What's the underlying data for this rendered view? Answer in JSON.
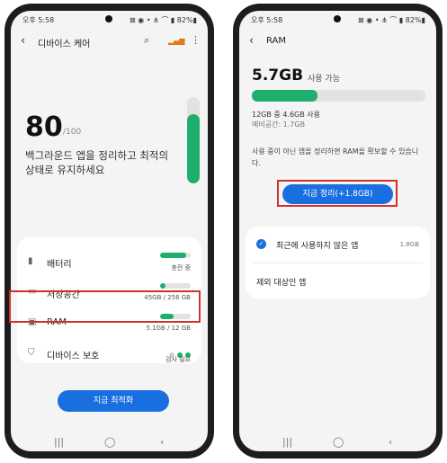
{
  "status_bar": {
    "time": "오후 5:58",
    "icons": "⊠ ◉ • ⋔ ⌒ ▮ 82%▮"
  },
  "left": {
    "appbar": {
      "back": "‹",
      "title": "디바이스 케어",
      "search": "⌕",
      "signal": "▂▄▆",
      "more": "⋮"
    },
    "score": {
      "value": "80",
      "max": "/100",
      "fill": 0.8
    },
    "description": "백그라운드 앱을 정리하고 최적의 상태로 유지하세요",
    "items": [
      {
        "icon": "battery-icon",
        "glyph": "▮",
        "label": "배터리",
        "status": "충전 중",
        "fill": 0.85
      },
      {
        "icon": "storage-icon",
        "glyph": "▭",
        "label": "저장공간",
        "status": "45GB / 256 GB",
        "fill": 0.18
      },
      {
        "icon": "ram-chip-icon",
        "glyph": "▣",
        "label": "RAM",
        "status": "5.1GB / 12 GB",
        "fill": 0.43
      },
      {
        "icon": "shield-icon",
        "glyph": "⛉",
        "label": "디바이스 보호",
        "status": "검사 필요"
      }
    ],
    "optimize_button": "지금 최적화",
    "nav": {
      "recents": "|||",
      "home": "◯",
      "back": "‹"
    }
  },
  "right": {
    "appbar": {
      "back": "‹",
      "title": "RAM"
    },
    "available_value": "5.7GB",
    "available_label": "사용 가능",
    "usage_fill": 0.38,
    "usage_text": "12GB 중 4.6GB 사용",
    "spare_text": "예비공간: 1.7GB",
    "info_text": "사용 중이 아닌 앱을 정리하면 RAM을 확보할 수 있습니다.",
    "clean_button": "지금 정리(+1.8GB)",
    "unused_label": "최근에 사용하지 않은 앱",
    "unused_size": "1.8GB",
    "check": "✓",
    "excluded_label": "제외 대상인 앱",
    "nav": {
      "recents": "|||",
      "home": "◯",
      "back": "‹"
    }
  },
  "colors": {
    "accent_green": "#1fae6b",
    "accent_blue": "#1a6fe0",
    "highlight_red": "#d0312d"
  }
}
